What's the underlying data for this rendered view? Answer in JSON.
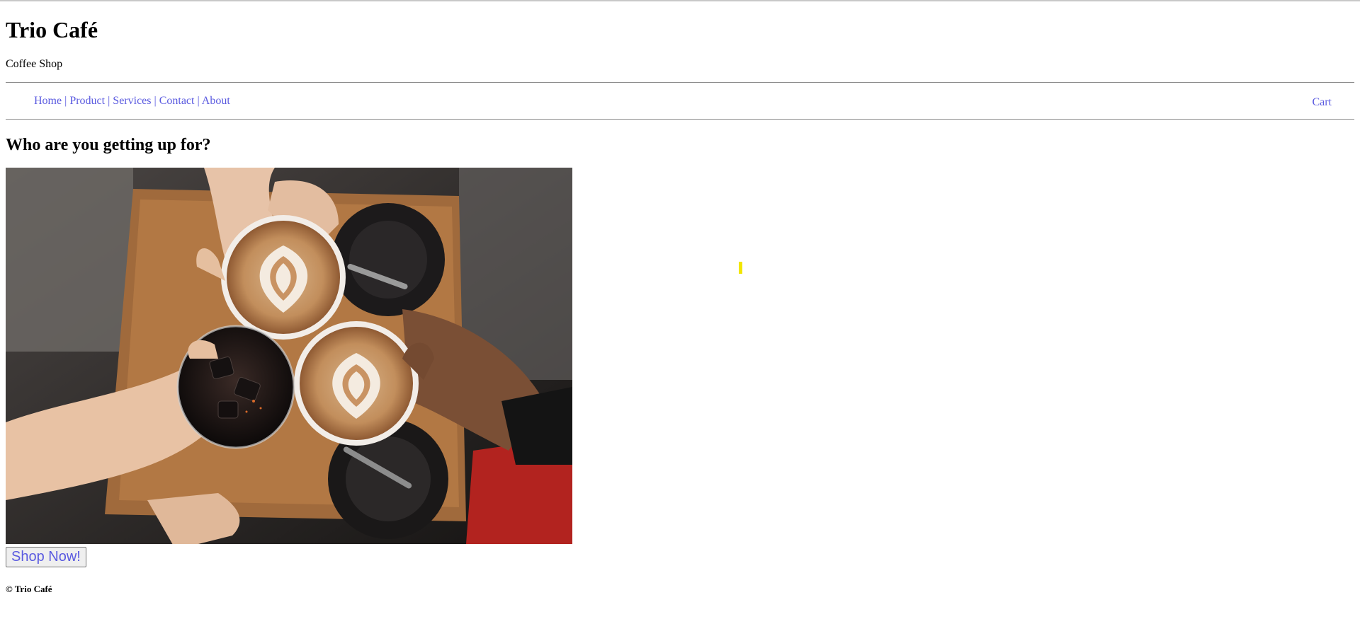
{
  "site": {
    "title": "Trio Café",
    "tagline": "Coffee Shop"
  },
  "nav": {
    "items": [
      {
        "label": "Home"
      },
      {
        "label": "Product"
      },
      {
        "label": "Services"
      },
      {
        "label": "Contact"
      },
      {
        "label": "About"
      }
    ],
    "separator": "|",
    "cart_label": "Cart"
  },
  "main": {
    "headline": "Who are you getting up for?",
    "hero_image": {
      "icon": "coffee-cups-toast-photo"
    },
    "cta_label": "Shop Now!"
  },
  "footer": {
    "text": "© Trio Café"
  },
  "colors": {
    "link": "#5a5ae0",
    "rule": "#8a8a8a",
    "marker": "#f2e600"
  }
}
